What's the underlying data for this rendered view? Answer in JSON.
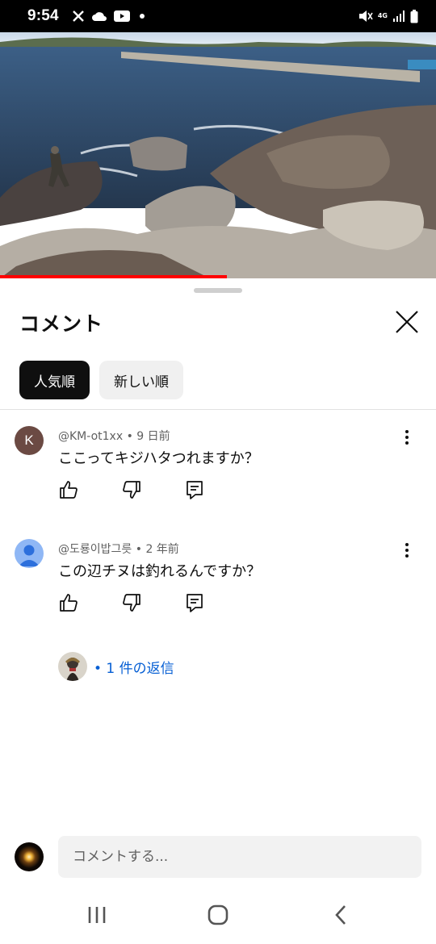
{
  "status_bar": {
    "time": "9:54",
    "network": "4G",
    "icons": [
      "x-icon",
      "cloud-icon",
      "youtube-icon",
      "dot-icon",
      "mute-icon",
      "signal-icon",
      "battery-icon"
    ]
  },
  "video": {
    "progress_fraction": 0.52,
    "progress_color": "#ff0000"
  },
  "comments_sheet": {
    "title": "コメント",
    "sort_chips": [
      {
        "label": "人気順",
        "selected": true
      },
      {
        "label": "新しい順",
        "selected": false
      }
    ],
    "comments": [
      {
        "avatar_letter": "K",
        "author": "@KM-ot1xx",
        "time": "9 日前",
        "text": "ここってキジハタつれますか？"
      },
      {
        "avatar_letter": "",
        "author": "@도룡이밥그릇",
        "time": "2 年前",
        "text": "この辺チヌは釣れるんですか？"
      }
    ],
    "replies": {
      "label": "• 1 件の返信"
    },
    "input": {
      "placeholder": "コメントする..."
    }
  },
  "colors": {
    "accent_link": "#065fd4",
    "chip_selected_bg": "#0f0f0f",
    "chip_bg": "#f0f0f0"
  }
}
